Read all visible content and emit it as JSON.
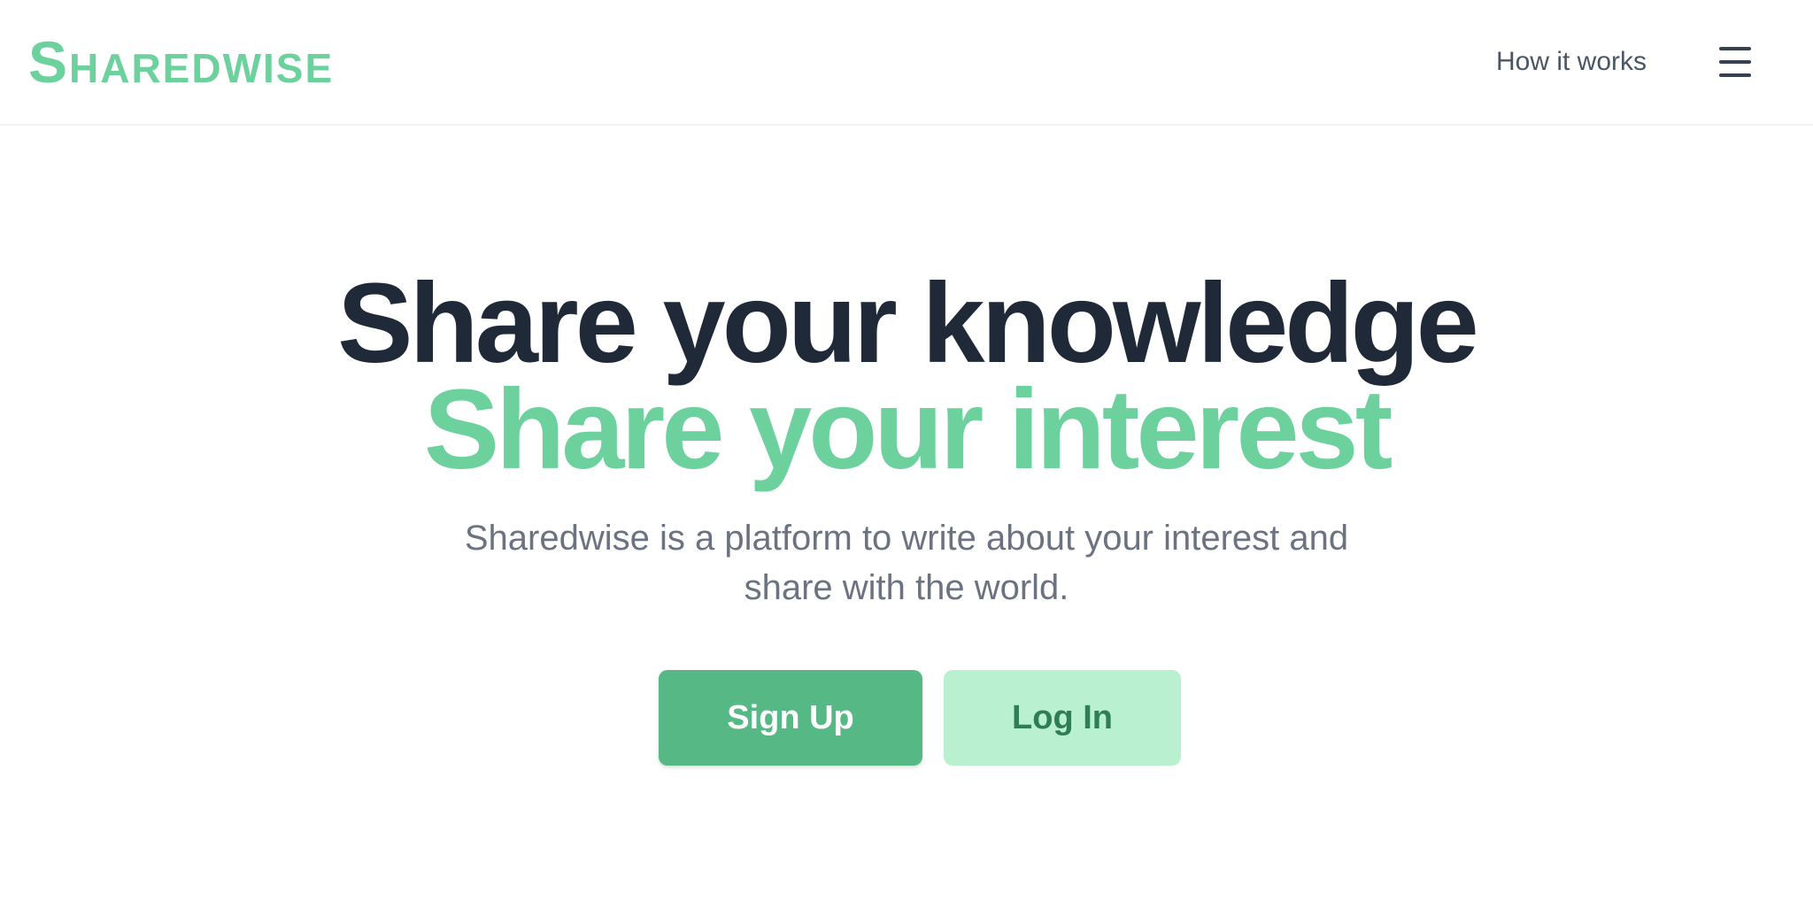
{
  "header": {
    "logo_text": "Sharedwise",
    "nav_link": "How it works",
    "menu_icon": "hamburger-menu-icon"
  },
  "hero": {
    "headline_line1": "Share your knowledge",
    "headline_line2": "Share your interest",
    "subtitle": "Sharedwise is a platform to write about your interest and share with the world.",
    "primary_button": "Sign Up",
    "secondary_button": "Log In"
  },
  "colors": {
    "brand_green": "#6cd19d",
    "primary_button": "#56b884",
    "secondary_button": "#b8f0d0",
    "headline_dark": "#1f2937",
    "body_text": "#6b7280"
  }
}
